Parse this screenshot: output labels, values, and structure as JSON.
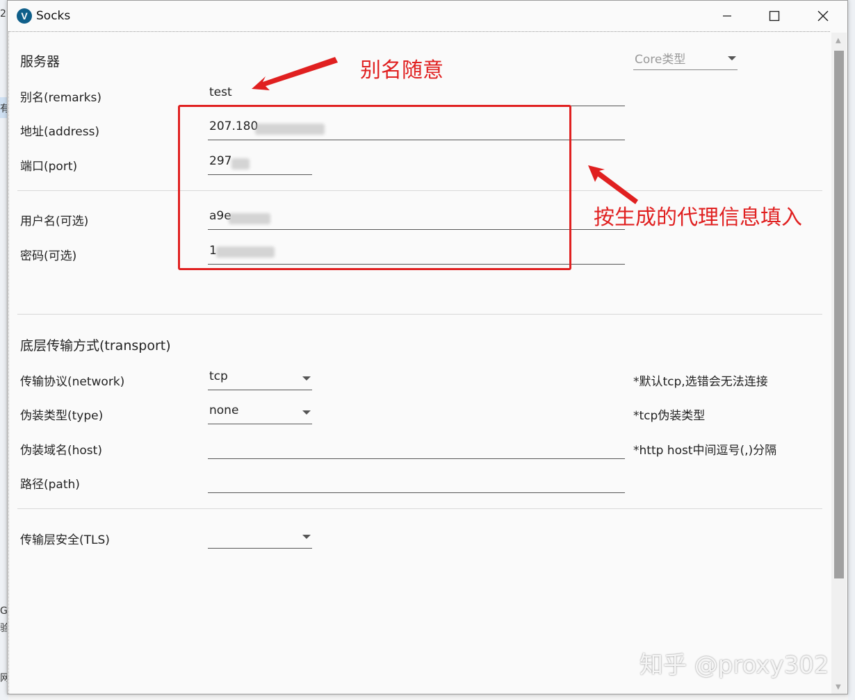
{
  "window": {
    "title": "Socks"
  },
  "server": {
    "heading": "服务器",
    "core_type_placeholder": "Core类型",
    "fields": {
      "remarks": {
        "label": "别名(remarks)",
        "value": "test"
      },
      "address": {
        "label": "地址(address)",
        "value": "207.180"
      },
      "port": {
        "label": "端口(port)",
        "value": "297"
      },
      "username": {
        "label": "用户名(可选)",
        "value": "a9e"
      },
      "password": {
        "label": "密码(可选)",
        "value": "1"
      }
    }
  },
  "transport": {
    "heading": "底层传输方式(transport)",
    "network": {
      "label": "传输协议(network)",
      "value": "tcp",
      "hint": "*默认tcp,选错会无法连接"
    },
    "type": {
      "label": "伪装类型(type)",
      "value": "none",
      "hint": "*tcp伪装类型"
    },
    "host": {
      "label": "伪装域名(host)",
      "value": "",
      "hint": "*http host中间逗号(,)分隔"
    },
    "path": {
      "label": "路径(path)",
      "value": ""
    },
    "tls": {
      "label": "传输层安全(TLS)",
      "value": ""
    }
  },
  "annotations": {
    "alias_note": "别名随意",
    "proxy_note": "按生成的代理信息填入"
  },
  "watermark": "知乎 @proxy302",
  "background_fragments": [
    "2",
    "有",
    "G",
    "验",
    "网"
  ],
  "colors": {
    "annotation": "#e02020",
    "window_bg": "#fafafa",
    "scroll_thumb": "#a0a0a0"
  }
}
